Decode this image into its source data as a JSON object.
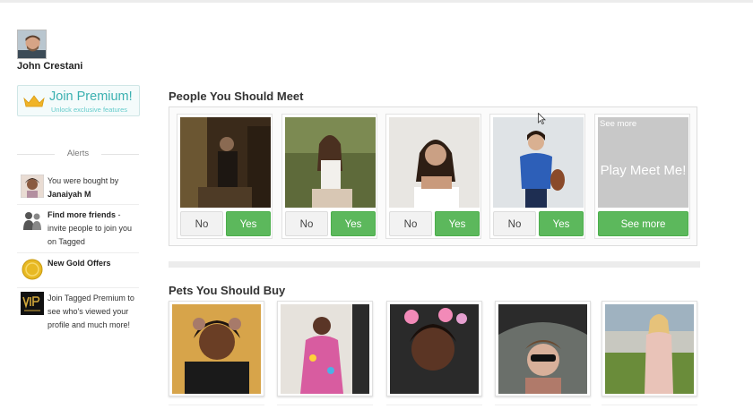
{
  "user": {
    "name": "John Crestani"
  },
  "premium": {
    "title": "Join Premium!",
    "subtitle": "Unlock exclusive features"
  },
  "alerts": {
    "heading": "Alerts",
    "items": [
      {
        "text": "You were bought by",
        "bold": "Janaiyah M"
      },
      {
        "bold": "Find more friends",
        "text": " - invite people to join you on Tagged"
      },
      {
        "bold": "New Gold Offers"
      },
      {
        "text": "Join Tagged Premium to see who's viewed your profile and much more!"
      }
    ]
  },
  "meet": {
    "title": "People You Should Meet",
    "no_label": "No",
    "yes_label": "Yes",
    "see_more_label": "See more",
    "play_top_label": "See more",
    "play_text": "Play Meet Me!"
  },
  "pets": {
    "title": "Pets You Should Buy"
  },
  "colors": {
    "accent_green": "#5cb85c",
    "premium_teal": "#3ab0b0"
  }
}
